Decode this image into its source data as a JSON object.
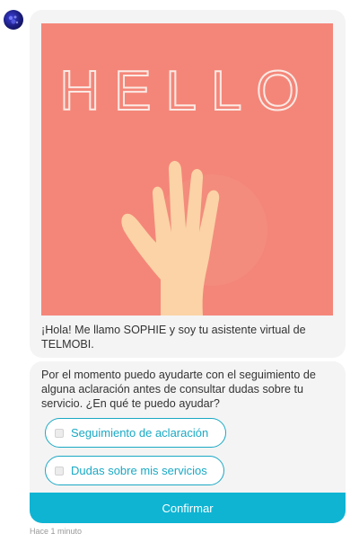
{
  "bot": {
    "avatar_icon": "bot-avatar-icon"
  },
  "message1": {
    "image_text": "HELLO",
    "image_alt": "waving-hand-illustration",
    "image_bg_color": "#f48679",
    "text": "¡Hola! Me llamo SOPHIE y soy tu asistente virtual de TELMOBI."
  },
  "message2": {
    "text": "Por el momento puedo ayudarte con el seguimiento de alguna aclaración antes de consultar dudas sobre tu servicio. ¿En qué te puedo ayudar?",
    "options": [
      {
        "label": "Seguimiento de aclaración",
        "checked": false
      },
      {
        "label": "Dudas sobre mis servicios",
        "checked": false
      }
    ],
    "confirm_label": "Confirmar",
    "accent_color": "#0fb4d3"
  },
  "timestamp": "Hace 1 minuto"
}
